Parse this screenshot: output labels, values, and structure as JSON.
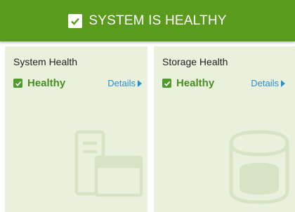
{
  "banner": {
    "title": "SYSTEM IS HEALTHY",
    "icon": "checkbox-checked-icon",
    "color": "#5a9a1c"
  },
  "cards": [
    {
      "title": "System Health",
      "status": "Healthy",
      "details": "Details",
      "watermark_icon": "server-window-icon"
    },
    {
      "title": "Storage Health",
      "status": "Healthy",
      "details": "Details",
      "watermark_icon": "database-icon"
    }
  ],
  "colors": {
    "card_bg": "#e9f1dd",
    "healthy_text": "#4a8f22",
    "link": "#2b8fcf"
  }
}
